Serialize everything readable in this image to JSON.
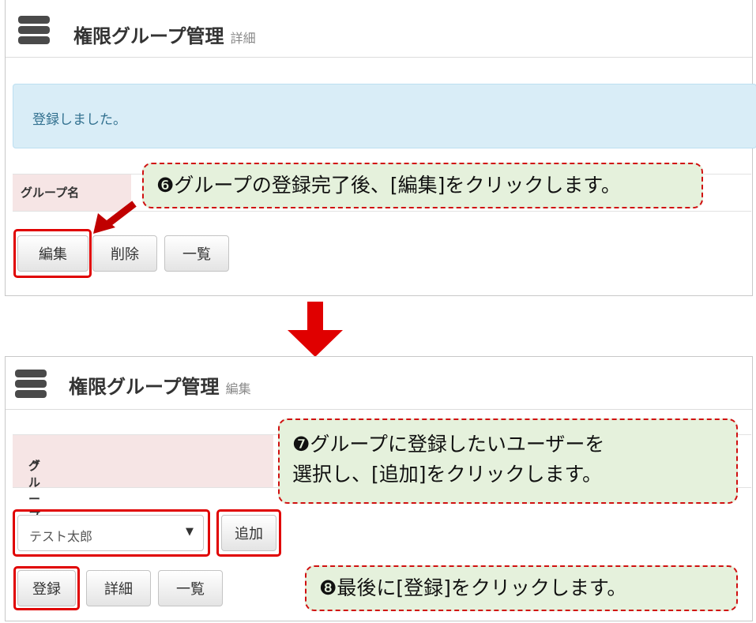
{
  "detail_panel": {
    "title": "権限グループ管理",
    "subtitle": "詳細",
    "alert": "登録しました。",
    "field_label": "グループ名",
    "buttons": {
      "edit": "編集",
      "delete": "削除",
      "list": "一覧"
    }
  },
  "edit_panel": {
    "title": "権限グループ管理",
    "subtitle": "編集",
    "field_label": "グループ名",
    "required_mark": "*",
    "user_select": {
      "value": "テスト太郎",
      "caret": "▼"
    },
    "buttons": {
      "add": "追加",
      "register": "登録",
      "detail": "詳細",
      "list": "一覧"
    }
  },
  "callouts": {
    "step6": "❻グループの登録完了後、[編集]をクリックします。",
    "step7_line1": "❼グループに登録したいユーザーを",
    "step7_line2": "選択し、[追加]をクリックします。",
    "step8": "❽最後に[登録]をクリックします。"
  },
  "colors": {
    "highlight": "#e00000",
    "callout_bg": "#e5f1dc",
    "alert_bg": "#d9edf7",
    "alert_text": "#31708f",
    "label_bg": "#f6e5e5"
  },
  "icons": [
    "database-icon",
    "arrow-icon"
  ]
}
